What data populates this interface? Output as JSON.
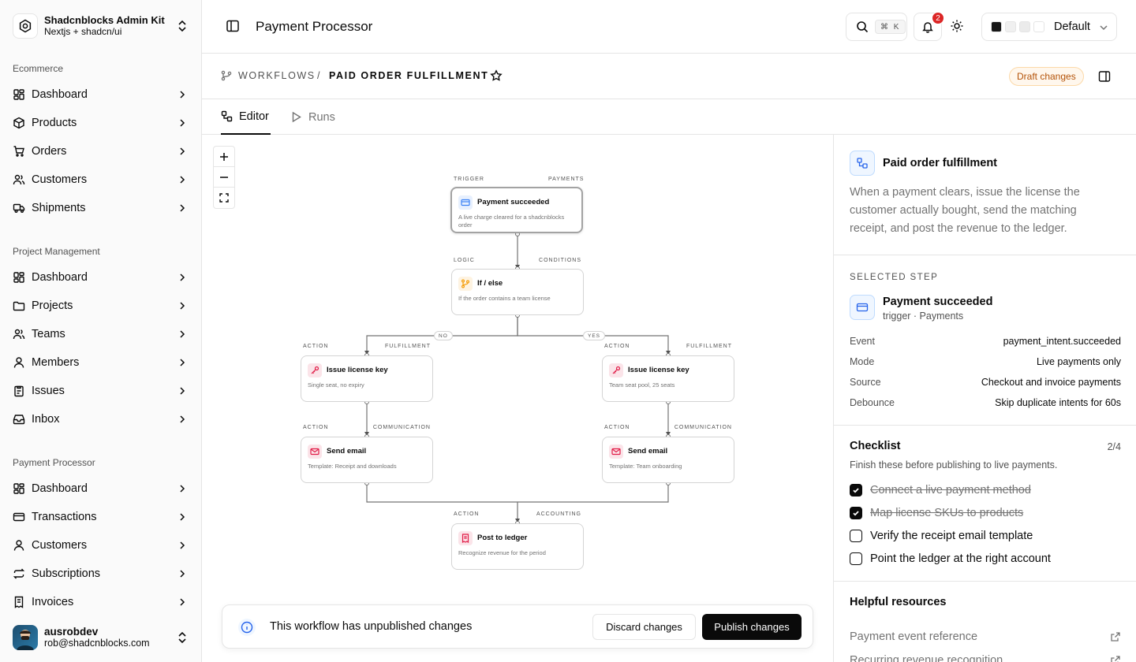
{
  "brand": {
    "title": "Shadcnblocks Admin Kit",
    "subtitle": "Nextjs + shadcn/ui"
  },
  "sidebar": {
    "groups": [
      {
        "label": "Ecommerce",
        "items": [
          {
            "label": "Dashboard",
            "icon": "dashboard-icon"
          },
          {
            "label": "Products",
            "icon": "package-icon"
          },
          {
            "label": "Orders",
            "icon": "cart-icon"
          },
          {
            "label": "Customers",
            "icon": "users-icon"
          },
          {
            "label": "Shipments",
            "icon": "truck-icon"
          }
        ]
      },
      {
        "label": "Project Management",
        "items": [
          {
            "label": "Dashboard",
            "icon": "dashboard-icon"
          },
          {
            "label": "Projects",
            "icon": "folder-icon"
          },
          {
            "label": "Teams",
            "icon": "users-icon"
          },
          {
            "label": "Members",
            "icon": "user-icon"
          },
          {
            "label": "Issues",
            "icon": "clipboard-icon"
          },
          {
            "label": "Inbox",
            "icon": "inbox-icon"
          }
        ]
      },
      {
        "label": "Payment Processor",
        "items": [
          {
            "label": "Dashboard",
            "icon": "dashboard-icon"
          },
          {
            "label": "Transactions",
            "icon": "credit-card-icon"
          },
          {
            "label": "Customers",
            "icon": "user-icon"
          },
          {
            "label": "Subscriptions",
            "icon": "repeat-icon"
          },
          {
            "label": "Invoices",
            "icon": "receipt-icon"
          }
        ]
      }
    ]
  },
  "user": {
    "name": "ausrobdev",
    "email": "rob@shadcnblocks.com"
  },
  "header": {
    "title": "Payment Processor",
    "search_kbd": "⌘ K",
    "notification_count": "2",
    "theme_label": "Default",
    "theme_swatches": [
      "#171717",
      "#f0f0f0",
      "#ebebeb",
      "#ffffff"
    ]
  },
  "breadcrumb": {
    "root": "WORKFLOWS",
    "separator": "/",
    "current": "PAID ORDER FULFILLMENT",
    "status": "Draft changes"
  },
  "tabs": [
    {
      "label": "Editor",
      "active": true
    },
    {
      "label": "Runs",
      "active": false
    }
  ],
  "workflow": {
    "nodes": [
      {
        "id": "trigger",
        "category": "TRIGGER",
        "tag": "PAYMENTS",
        "title": "Payment succeeded",
        "desc": "A live charge cleared for a shadcnblocks order",
        "icon": "credit-card-icon",
        "color": "#3b82f6",
        "selected": true
      },
      {
        "id": "ifelse",
        "category": "LOGIC",
        "tag": "CONDITIONS",
        "title": "If / else",
        "desc": "If the order contains a team license",
        "icon": "git-branch-icon",
        "color": "#f59e0b",
        "selected": false
      },
      {
        "id": "key-no",
        "category": "ACTION",
        "tag": "FULFILLMENT",
        "title": "Issue license key",
        "desc": "Single seat, no expiry",
        "icon": "key-icon",
        "color": "#e11d48",
        "selected": false
      },
      {
        "id": "key-yes",
        "category": "ACTION",
        "tag": "FULFILLMENT",
        "title": "Issue license key",
        "desc": "Team seat pool, 25 seats",
        "icon": "key-icon",
        "color": "#e11d48",
        "selected": false
      },
      {
        "id": "email-no",
        "category": "ACTION",
        "tag": "COMMUNICATION",
        "title": "Send email",
        "desc": "Template: Receipt and downloads",
        "icon": "mail-icon",
        "color": "#e11d48",
        "selected": false
      },
      {
        "id": "email-yes",
        "category": "ACTION",
        "tag": "COMMUNICATION",
        "title": "Send email",
        "desc": "Template: Team onboarding",
        "icon": "mail-icon",
        "color": "#e11d48",
        "selected": false
      },
      {
        "id": "ledger",
        "category": "ACTION",
        "tag": "ACCOUNTING",
        "title": "Post to ledger",
        "desc": "Recognize revenue for the period",
        "icon": "receipt-icon",
        "color": "#e11d48",
        "selected": false
      }
    ],
    "branch_labels": {
      "no": "NO",
      "yes": "YES"
    }
  },
  "banner": {
    "text": "This workflow has unpublished changes",
    "discard": "Discard changes",
    "publish": "Publish changes"
  },
  "panel": {
    "title": "Paid order fulfillment",
    "description": "When a payment clears, issue the license the customer actually bought, send the matching receipt, and post the revenue to the ledger.",
    "selected_label": "SELECTED STEP",
    "selected_title": "Payment succeeded",
    "selected_sub": "trigger · Payments",
    "props": [
      {
        "key": "Event",
        "value": "payment_intent.succeeded"
      },
      {
        "key": "Mode",
        "value": "Live payments only"
      },
      {
        "key": "Source",
        "value": "Checkout and invoice payments"
      },
      {
        "key": "Debounce",
        "value": "Skip duplicate intents for 60s"
      }
    ],
    "checklist": {
      "title": "Checklist",
      "count": "2/4",
      "subtitle": "Finish these before publishing to live payments.",
      "items": [
        {
          "label": "Connect a live payment method",
          "done": true
        },
        {
          "label": "Map license SKUs to products",
          "done": true
        },
        {
          "label": "Verify the receipt email template",
          "done": false
        },
        {
          "label": "Point the ledger at the right account",
          "done": false
        }
      ]
    },
    "resources": {
      "title": "Helpful resources",
      "links": [
        "Payment event reference",
        "Recurring revenue recognition"
      ]
    }
  }
}
